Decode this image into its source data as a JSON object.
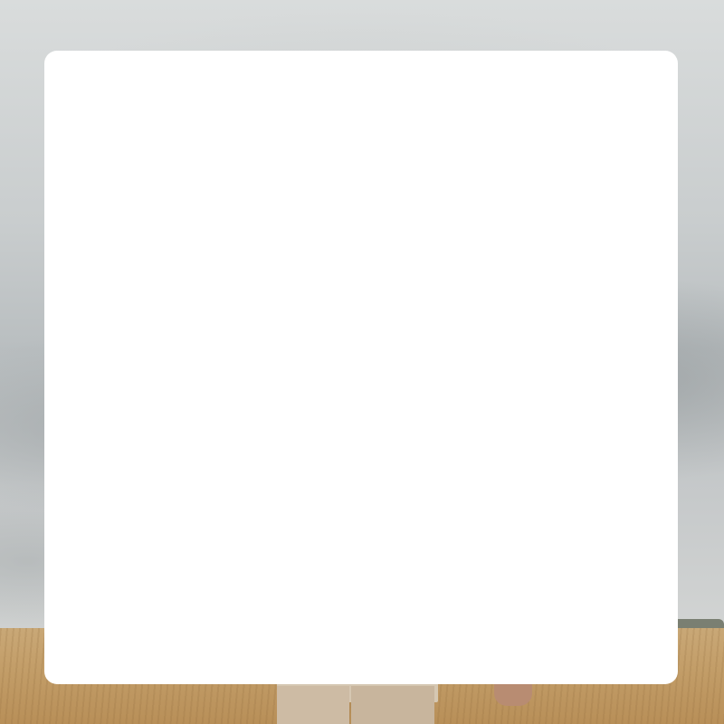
{
  "background": {
    "image": "field-woman-photo",
    "colors": {
      "sky": "#c9cdce",
      "field": "#c39e69",
      "coat": "#d5c7b2"
    }
  },
  "card": {
    "background_color": "#ffffff"
  }
}
